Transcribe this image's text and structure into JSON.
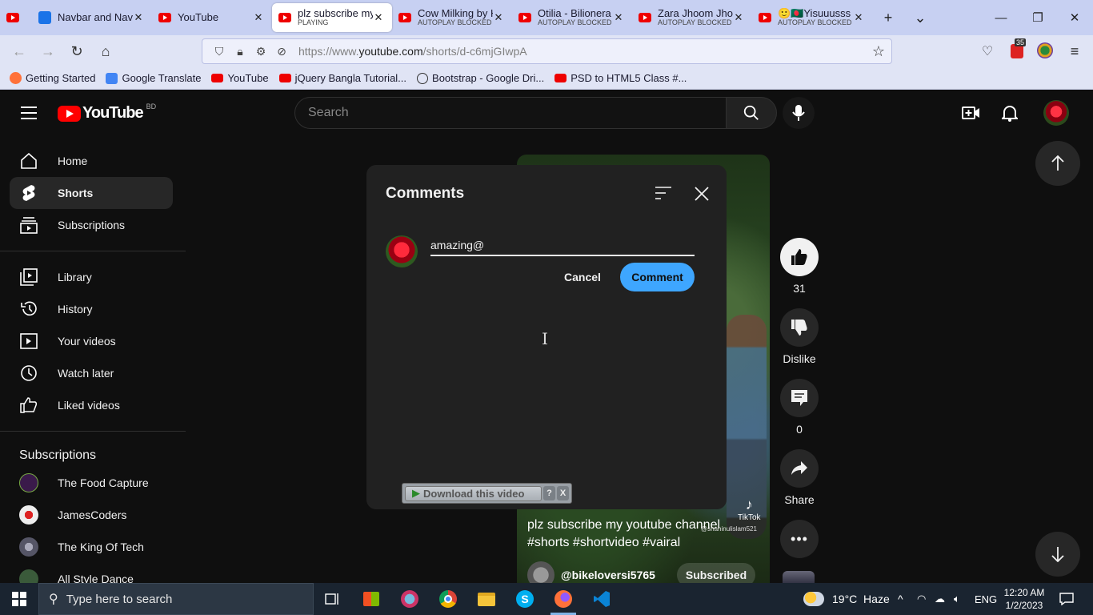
{
  "browser": {
    "tabs": [
      {
        "title": "",
        "sub": ""
      },
      {
        "title": "Navbar and Nav",
        "sub": ""
      },
      {
        "title": "YouTube",
        "sub": ""
      },
      {
        "title": "plz subscribe my y",
        "sub": "PLAYING"
      },
      {
        "title": "Cow Milking by H",
        "sub": "AUTOPLAY BLOCKED"
      },
      {
        "title": "Otilia - Bilionera (",
        "sub": "AUTOPLAY BLOCKED"
      },
      {
        "title": "Zara Jhoom Jhoom",
        "sub": "AUTOPLAY BLOCKED"
      },
      {
        "title": "🙂🇧🇩Yisuuusss -",
        "sub": "AUTOPLAY BLOCKED"
      }
    ],
    "url_prefix": "https://www.",
    "url_domain": "youtube.com",
    "url_path": "/shorts/d-c6mjGIwpA",
    "extension_badge": "35",
    "bookmarks": [
      {
        "label": "Getting Started",
        "icon": "firefox-icon"
      },
      {
        "label": "Google Translate",
        "icon": "translate-icon"
      },
      {
        "label": "YouTube",
        "icon": "youtube-icon"
      },
      {
        "label": "jQuery Bangla Tutorial...",
        "icon": "youtube-icon"
      },
      {
        "label": "Bootstrap - Google Dri...",
        "icon": "globe-icon"
      },
      {
        "label": "PSD to HTML5 Class #...",
        "icon": "youtube-icon"
      }
    ]
  },
  "youtube": {
    "logo_word": "YouTube",
    "country_code": "BD",
    "search_placeholder": "Search",
    "sidebar": [
      {
        "label": "Home",
        "icon": "home-icon"
      },
      {
        "label": "Shorts",
        "icon": "shorts-icon"
      },
      {
        "label": "Subscriptions",
        "icon": "subscriptions-icon"
      },
      {
        "label": "Library",
        "icon": "library-icon"
      },
      {
        "label": "History",
        "icon": "history-icon"
      },
      {
        "label": "Your videos",
        "icon": "your-videos-icon"
      },
      {
        "label": "Watch later",
        "icon": "watch-later-icon"
      },
      {
        "label": "Liked videos",
        "icon": "liked-videos-icon"
      }
    ],
    "subscriptions_heading": "Subscriptions",
    "subscriptions": [
      {
        "label": "The Food Capture",
        "color": "#3a1a4a"
      },
      {
        "label": "JamesCoders",
        "color": "#e8e8e8"
      },
      {
        "label": "The King Of Tech",
        "color": "#6a6a7a"
      },
      {
        "label": "All Style Dance",
        "color": "#3a5a3a"
      }
    ],
    "short": {
      "caption_line1": "plz subscribe my youtube channel",
      "caption_line2": "#shorts #shortvideo #vairal",
      "watermark": "TikTok",
      "watermark_handle": "@shahinulislam521",
      "channel": "@bikeloversi5765",
      "subscribe_state": "Subscribed"
    },
    "actions": {
      "likes": "31",
      "dislike": "Dislike",
      "comments": "0",
      "share": "Share"
    },
    "comments": {
      "title": "Comments",
      "input_value": "amazing@",
      "cancel": "Cancel",
      "comment": "Comment"
    },
    "download_bar": {
      "label": "Download this video",
      "help": "?",
      "close": "X"
    }
  },
  "taskbar": {
    "search_placeholder": "Type here to search",
    "weather": "19°C  Haze",
    "language": "ENG",
    "time": "12:20 AM",
    "date": "1/2/2023"
  },
  "colors": {
    "accent_blue": "#3ea6ff",
    "youtube_red": "#ff0000",
    "background": "#0f0f0f",
    "dialog": "#212121"
  }
}
